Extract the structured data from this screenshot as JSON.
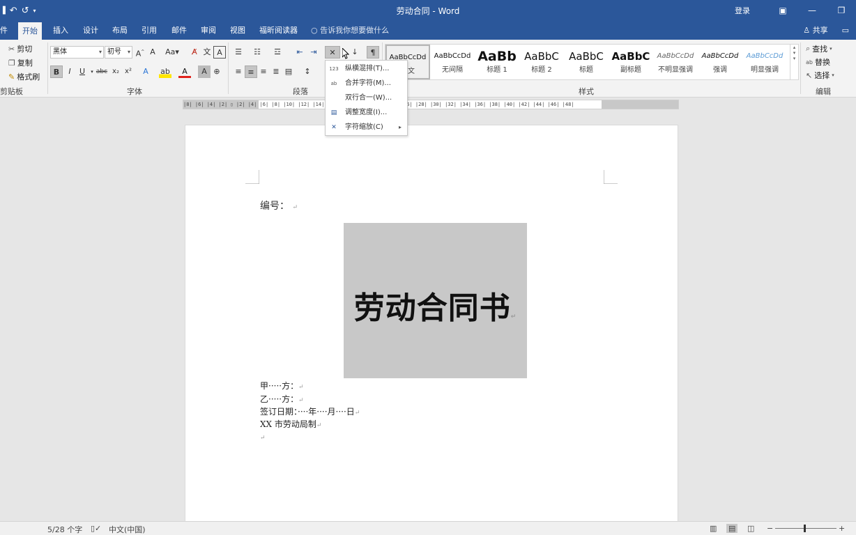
{
  "window": {
    "title": "劳动合同 - Word",
    "login": "登录",
    "qat": [
      "↶",
      "↺",
      "▾"
    ]
  },
  "tabs": {
    "items": [
      {
        "label": "件"
      },
      {
        "label": "开始"
      },
      {
        "label": "插入"
      },
      {
        "label": "设计"
      },
      {
        "label": "布局"
      },
      {
        "label": "引用"
      },
      {
        "label": "邮件"
      },
      {
        "label": "审阅"
      },
      {
        "label": "视图"
      },
      {
        "label": "福昕阅读器"
      }
    ],
    "active": "开始",
    "tell_me": "告诉我你想要做什么",
    "share": "共享"
  },
  "ribbon": {
    "clipboard": {
      "cut": "剪切",
      "copy": "复制",
      "format_painter": "格式刷",
      "label": "剪贴板"
    },
    "font": {
      "name": "黑体",
      "size": "初号",
      "label": "字体",
      "change_case": "Aa"
    },
    "paragraph": {
      "label": "段落"
    },
    "styles": {
      "label": "样式",
      "items": [
        {
          "preview": "AaBbCcDd",
          "name": "正文"
        },
        {
          "preview": "AaBbCcDd",
          "name": "无间隔"
        },
        {
          "preview": "AaBb",
          "name": "标题 1"
        },
        {
          "preview": "AaBbC",
          "name": "标题 2"
        },
        {
          "preview": "AaBbC",
          "name": "标题"
        },
        {
          "preview": "AaBbC",
          "name": "副标题"
        },
        {
          "preview": "AaBbCcDd",
          "name": "不明显强调"
        },
        {
          "preview": "AaBbCcDd",
          "name": "强调"
        },
        {
          "preview": "AaBbCcDd",
          "name": "明显强调"
        }
      ]
    },
    "editing": {
      "find": "查找",
      "replace": "替换",
      "select": "选择",
      "label": "编辑"
    }
  },
  "menu": {
    "items": [
      {
        "icon": "123",
        "label": "纵横混排(T)..."
      },
      {
        "icon": "ab",
        "label": "合并字符(M)..."
      },
      {
        "icon": "",
        "label": "双行合一(W)..."
      },
      {
        "icon": "▤",
        "label": "调整宽度(I)..."
      },
      {
        "icon": "✕",
        "label": "字符缩放(C)"
      }
    ]
  },
  "ruler": {
    "text": "|8|  |6|  |4|  |2|  ▯  |2|  |4|  |6|  |8|  |10| |12| |14| |16| |18| |20| |22| |24| |26| |28| |30| |32| |34| |36| |38| |40| |42| |44| |46| |48|"
  },
  "document": {
    "number_label": "编号：",
    "cover_title": "劳动合同书",
    "lines": [
      "甲·····方：",
      "乙·····方：",
      "签订日期：····年····月····日",
      "XX 市劳动局制"
    ],
    "para_mark": "↵"
  },
  "statusbar": {
    "word_count": "5/28 个字",
    "language": "中文(中国)",
    "zoom_minus": "−",
    "zoom_plus": "+"
  },
  "colors": {
    "accent": "#2b579a",
    "ribbon": "#f3f3f3",
    "cover_bg": "#c8c8c8"
  }
}
